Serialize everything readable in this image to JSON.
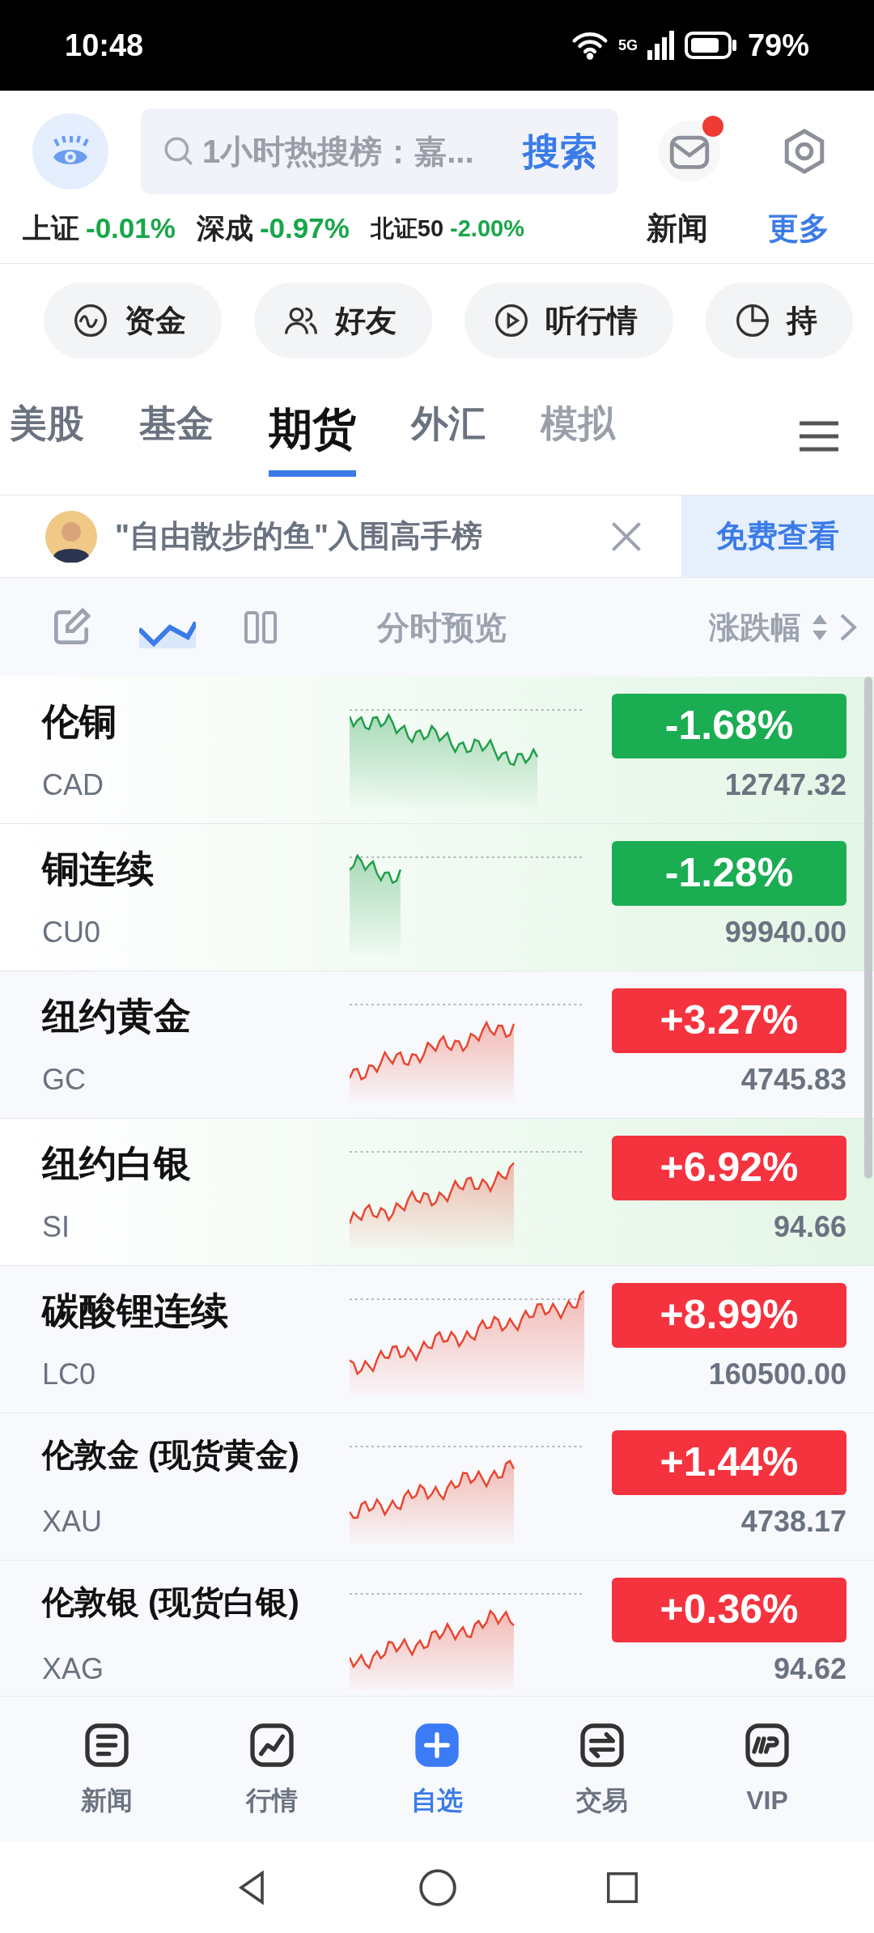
{
  "status_bar": {
    "time": "10:48",
    "network": "5G",
    "battery": "79%"
  },
  "header": {
    "search": {
      "placeholder": "1小时热搜榜：嘉...",
      "button": "搜索"
    },
    "news": {
      "label": "新闻",
      "unread": true
    },
    "more": "更多"
  },
  "indices": [
    {
      "name": "上证",
      "change": "-0.01%"
    },
    {
      "name": "深成",
      "change": "-0.97%"
    },
    {
      "name": "北证50",
      "change": "-2.00%"
    }
  ],
  "shortcuts": [
    {
      "label": "资金",
      "kind": "wave"
    },
    {
      "label": "好友",
      "kind": "friends"
    },
    {
      "label": "听行情",
      "kind": "play"
    },
    {
      "label": "持",
      "kind": "pie"
    }
  ],
  "tabs": [
    {
      "label": "美股",
      "selected": false
    },
    {
      "label": "基金",
      "selected": false
    },
    {
      "label": "期货",
      "selected": true
    },
    {
      "label": "外汇",
      "selected": false
    },
    {
      "label": "模拟",
      "selected": false
    }
  ],
  "banner": {
    "text": "\"自由散步的鱼\"入围高手榜",
    "button": "免费查看"
  },
  "toolbar": {
    "mode": "分时预览",
    "sort": "涨跌幅"
  },
  "rows": [
    {
      "name": "伦铜",
      "code": "CAD",
      "change": "-1.68%",
      "price": "12747.32",
      "rising": false,
      "highlighted": true
    },
    {
      "name": "铜连续",
      "code": "CU0",
      "change": "-1.28%",
      "price": "99940.00",
      "rising": false,
      "highlighted": true
    },
    {
      "name": "纽约黄金",
      "code": "GC",
      "change": "+3.27%",
      "price": "4745.83",
      "rising": true,
      "highlighted": false
    },
    {
      "name": "纽约白银",
      "code": "SI",
      "change": "+6.92%",
      "price": "94.66",
      "rising": true,
      "highlighted": true
    },
    {
      "name": "碳酸锂连续",
      "code": "LC0",
      "change": "+8.99%",
      "price": "160500.00",
      "rising": true,
      "highlighted": false
    },
    {
      "name": "伦敦金 (现货黄金)",
      "code": "XAU",
      "change": "+1.44%",
      "price": "4738.17",
      "rising": true,
      "highlighted": false
    },
    {
      "name": "伦敦银 (现货白银)",
      "code": "XAG",
      "change": "+0.36%",
      "price": "94.62",
      "rising": true,
      "highlighted": false
    }
  ],
  "bottom_nav": [
    {
      "label": "新闻",
      "selected": false,
      "kind": "news"
    },
    {
      "label": "行情",
      "selected": false,
      "kind": "chart"
    },
    {
      "label": "自选",
      "selected": true,
      "kind": "plus"
    },
    {
      "label": "交易",
      "selected": false,
      "kind": "trade"
    },
    {
      "label": "VIP",
      "selected": false,
      "kind": "vip"
    }
  ]
}
